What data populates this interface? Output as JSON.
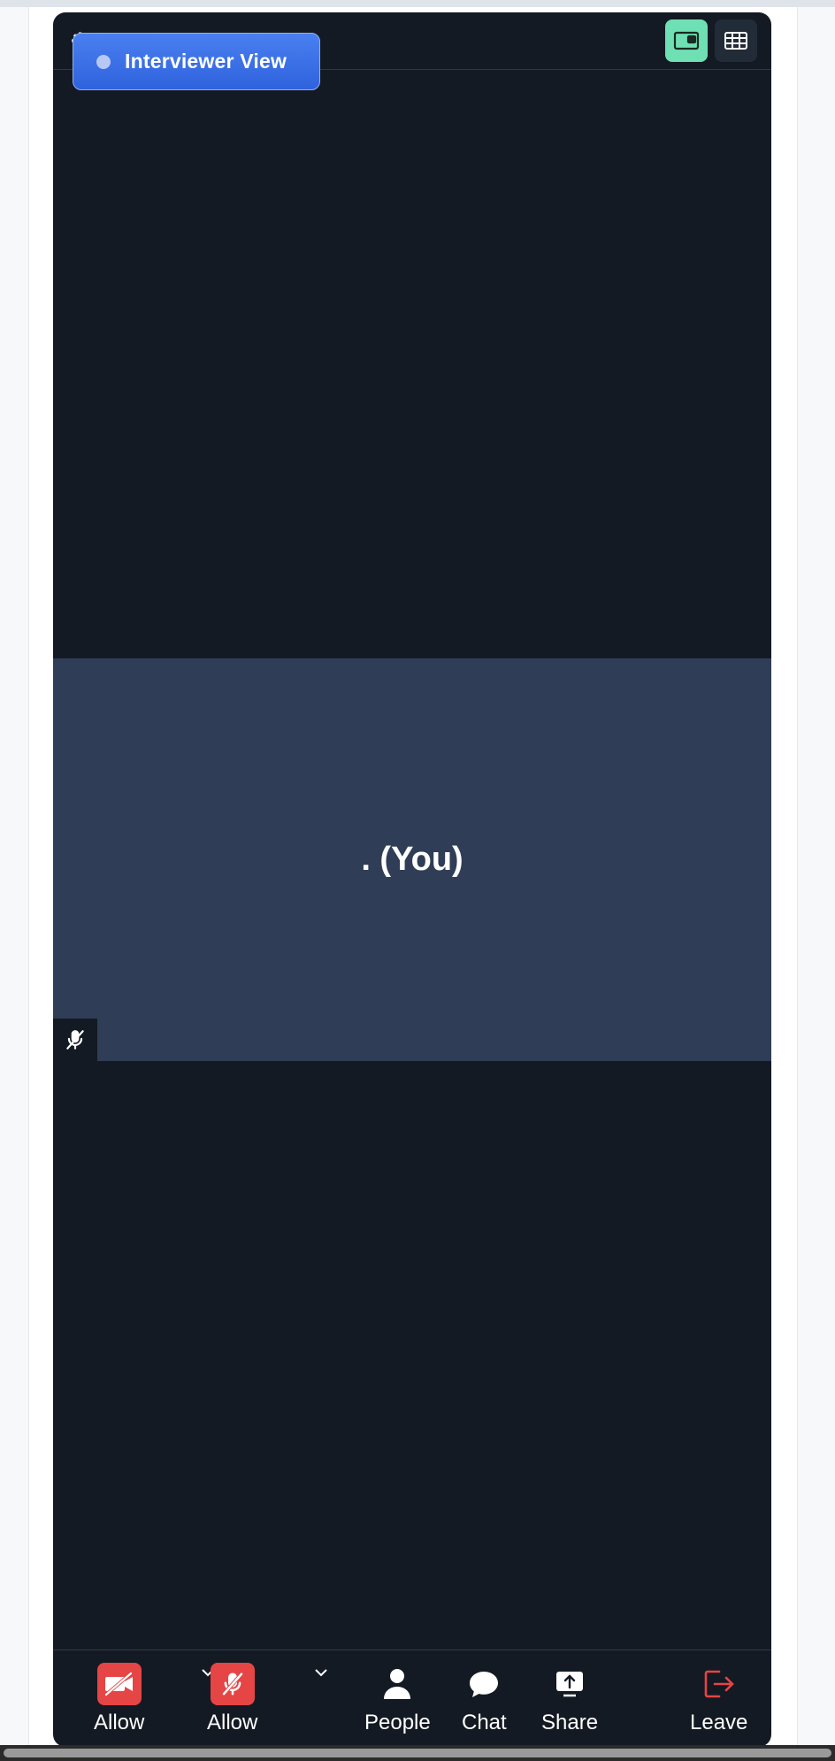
{
  "banner": {
    "label": "Interviewer View"
  },
  "self_tile": {
    "name": ". (You)",
    "muted": true
  },
  "view_controls": {
    "speaker_view_active": true,
    "grid_view_active": false
  },
  "toolbar": {
    "video": {
      "label": "Allow",
      "icon": "video-off-icon",
      "state": "off"
    },
    "audio": {
      "label": "Allow",
      "icon": "mic-off-icon",
      "state": "off"
    },
    "people": {
      "label": "People",
      "icon": "person-icon"
    },
    "chat": {
      "label": "Chat",
      "icon": "chat-bubble-icon"
    },
    "share": {
      "label": "Share",
      "icon": "share-screen-icon"
    },
    "leave": {
      "label": "Leave",
      "icon": "leave-icon"
    }
  },
  "colors": {
    "background": "#141a23",
    "self_tile": "#2f3e56",
    "banner": "#3b6fe6",
    "speaker_toggle_active": "#6ee0b3",
    "danger": "#e54545"
  }
}
